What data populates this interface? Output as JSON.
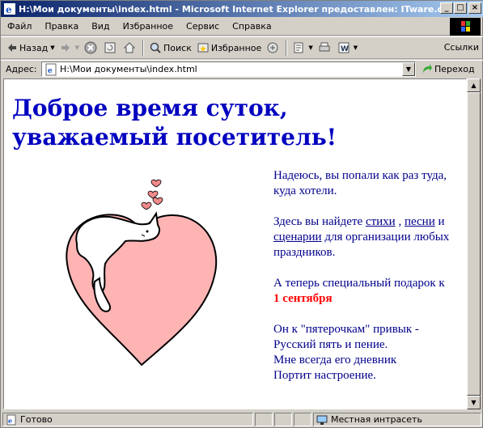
{
  "window": {
    "title": "H:\\Мои документы\\index.html - Microsoft Internet Explorer предоставлен: ITware.com...",
    "minimize": "_",
    "maximize": "□",
    "close": "×"
  },
  "menu": {
    "items": [
      "Файл",
      "Правка",
      "Вид",
      "Избранное",
      "Сервис",
      "Справка"
    ]
  },
  "toolbar": {
    "back": "Назад",
    "search": "Поиск",
    "favorites": "Избранное",
    "links": "Ссылки"
  },
  "address": {
    "label": "Адрес:",
    "value": "H:\\Мои документы\\index.html",
    "go": "Переход"
  },
  "page": {
    "heading": "Доброе время суток, уважаемый посетитель!",
    "p1": "Надеюсь, вы попали как раз туда, куда хотели.",
    "p2_prefix": "Здесь вы найдете ",
    "link_poems": "стихи",
    "comma": " , ",
    "link_songs": "песни",
    "and": " и ",
    "link_scenarios": "сценарии",
    "p2_suffix": " для организации любых праздников.",
    "p3": "А теперь специальный подарок к",
    "p3_date": "1 сентября",
    "poem": [
      "Он к \"пятерочкам\" привык -",
      "Русский пять и пение.",
      "Мне всегда его дневник",
      "Портит настроение."
    ]
  },
  "status": {
    "left": "Готово",
    "zone": "Местная интрасеть"
  }
}
